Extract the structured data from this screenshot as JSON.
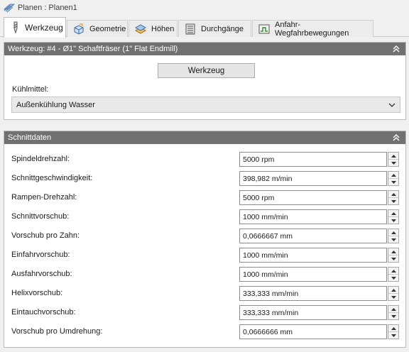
{
  "window": {
    "title": "Planen : Planen1",
    "icon": "layers-icon"
  },
  "tabs": [
    {
      "label": "Werkzeug",
      "icon": "end-mill-icon",
      "active": true
    },
    {
      "label": "Geometrie",
      "icon": "cube-icon",
      "active": false
    },
    {
      "label": "Höhen",
      "icon": "heights-icon",
      "active": false
    },
    {
      "label": "Durchgänge",
      "icon": "passes-icon",
      "active": false
    },
    {
      "label": "Anfahr-Wegfahrbewegungen",
      "icon": "linking-icon",
      "active": false
    }
  ],
  "tool_panel": {
    "header": "Werkzeug: #4 - Ø1\" Schaftfräser (1\" Flat Endmill)",
    "tool_button": "Werkzeug",
    "coolant_label": "Kühlmittel:",
    "coolant_value": "Außenkühlung Wasser"
  },
  "feeds_panel": {
    "header": "Schnittdaten",
    "rows": [
      {
        "label": "Spindeldrehzahl:",
        "value": "5000 rpm"
      },
      {
        "label": "Schnittgeschwindigkeit:",
        "value": "398,982 m/min"
      },
      {
        "label": "Rampen-Drehzahl:",
        "value": "5000 rpm"
      },
      {
        "label": "Schnittvorschub:",
        "value": "1000 mm/min"
      },
      {
        "label": "Vorschub pro Zahn:",
        "value": "0,0666667 mm"
      },
      {
        "label": "Einfahrvorschub:",
        "value": "1000 mm/min"
      },
      {
        "label": "Ausfahrvorschub:",
        "value": "1000 mm/min"
      },
      {
        "label": "Helixvorschub:",
        "value": "333,333 mm/min"
      },
      {
        "label": "Eintauchvorschub:",
        "value": "333,333 mm/min"
      },
      {
        "label": "Vorschub pro Umdrehung:",
        "value": "0,0666666 mm"
      }
    ]
  }
}
